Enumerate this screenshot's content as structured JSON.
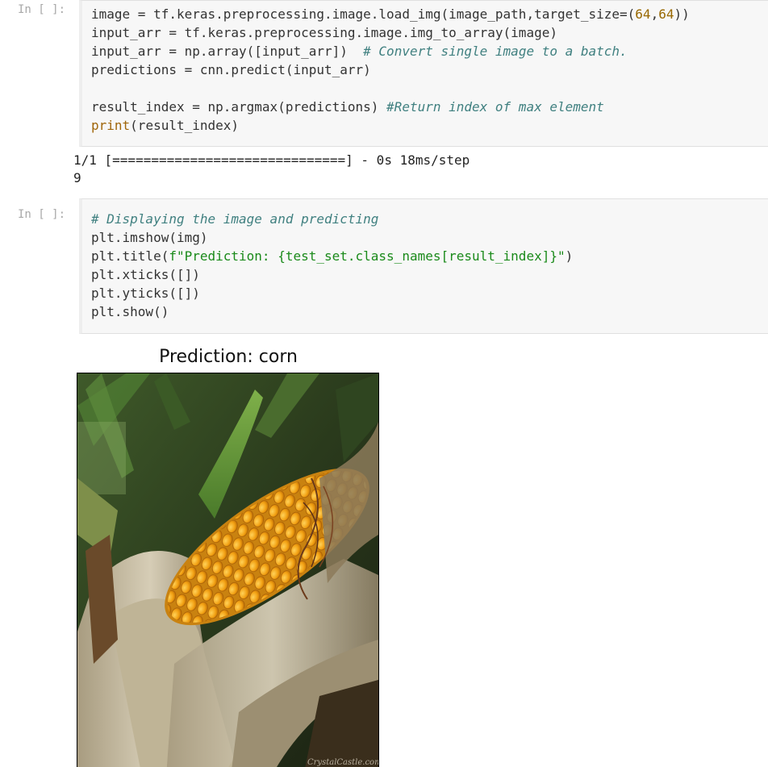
{
  "cells": [
    {
      "prompt": "In [ ]:",
      "code_lines": [
        [
          {
            "t": "image = tf.keras.preprocessing.image.load_img(image_path,target_size=("
          },
          {
            "t": "64",
            "c": "num"
          },
          {
            "t": ","
          },
          {
            "t": "64",
            "c": "num"
          },
          {
            "t": "))"
          }
        ],
        [
          {
            "t": "input_arr = tf.keras.preprocessing.image.img_to_array(image)"
          }
        ],
        [
          {
            "t": "input_arr = np.array([input_arr])  "
          },
          {
            "t": "# Convert single image to a batch.",
            "c": "cm"
          }
        ],
        [
          {
            "t": "predictions = cnn.predict(input_arr)"
          }
        ],
        [
          {
            "t": ""
          }
        ],
        [
          {
            "t": "result_index = np.argmax(predictions) "
          },
          {
            "t": "#Return index of max element",
            "c": "cm"
          }
        ],
        [
          {
            "t": "print",
            "c": "kw"
          },
          {
            "t": "(result_index)"
          }
        ]
      ],
      "output_lines": [
        "1/1 [==============================] - 0s 18ms/step",
        "9"
      ]
    },
    {
      "prompt": "In [ ]:",
      "code_lines": [
        [
          {
            "t": "# Displaying the image and predicting",
            "c": "cm"
          }
        ],
        [
          {
            "t": "plt.imshow(img)"
          }
        ],
        [
          {
            "t": "plt.title("
          },
          {
            "t": "f\"Prediction: {test_set.class_names[result_index]}\"",
            "c": "str"
          },
          {
            "t": ")"
          }
        ],
        [
          {
            "t": "plt.xticks([])"
          }
        ],
        [
          {
            "t": "plt.yticks([])"
          }
        ],
        [
          {
            "t": "plt.show()"
          }
        ]
      ]
    }
  ],
  "plot": {
    "title": "Prediction: corn",
    "image_subject": "corn-cob-photo",
    "watermark": "CrystalCastle.com"
  },
  "colors": {
    "prompt": "#a8a8a8",
    "comment": "#408080",
    "number": "#986801",
    "builtin": "#a0660a",
    "string": "#1a8a1a",
    "cell_bg": "#f7f7f7"
  }
}
